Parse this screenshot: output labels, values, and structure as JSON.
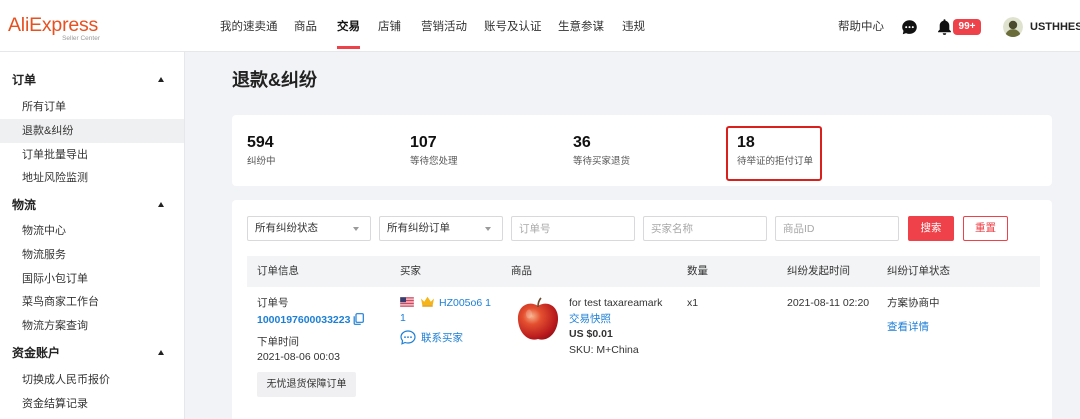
{
  "header": {
    "logo": {
      "brand": "AliExpress",
      "sub": "Seller Center"
    },
    "nav": [
      {
        "label": "我的速卖通",
        "active": false
      },
      {
        "label": "商品",
        "active": false
      },
      {
        "label": "交易",
        "active": true
      },
      {
        "label": "店铺",
        "active": false
      },
      {
        "label": "营销活动",
        "active": false
      },
      {
        "label": "账号及认证",
        "active": false
      },
      {
        "label": "生意参谋",
        "active": false
      },
      {
        "label": "违规",
        "active": false
      }
    ],
    "help": "帮助中心",
    "icons": {
      "messages": "chat-icon",
      "notifications": "bell-icon"
    },
    "notification_badge": "99+",
    "user_name": "USTHHES"
  },
  "sidebar": {
    "sections": [
      {
        "title": "订单",
        "expanded": true,
        "items": [
          {
            "label": "所有订单",
            "active": false
          },
          {
            "label": "退款&纠纷",
            "active": true
          },
          {
            "label": "订单批量导出",
            "active": false
          },
          {
            "label": "地址风险监测",
            "active": false
          }
        ]
      },
      {
        "title": "物流",
        "expanded": true,
        "items": [
          {
            "label": "物流中心",
            "active": false
          },
          {
            "label": "物流服务",
            "active": false
          },
          {
            "label": "国际小包订单",
            "active": false
          },
          {
            "label": "菜鸟商家工作台",
            "active": false
          },
          {
            "label": "物流方案查询",
            "active": false
          }
        ]
      },
      {
        "title": "资金账户",
        "expanded": true,
        "items": [
          {
            "label": "切换成人民币报价",
            "active": false
          },
          {
            "label": "资金结算记录",
            "active": false
          }
        ]
      }
    ]
  },
  "page": {
    "title": "退款&纠纷"
  },
  "stats": [
    {
      "value": 594,
      "label": "纠纷中",
      "highlighted": false
    },
    {
      "value": 107,
      "label": "等待您处理",
      "highlighted": false
    },
    {
      "value": 36,
      "label": "等待买家退货",
      "highlighted": false
    },
    {
      "value": 18,
      "label": "待举证的拒付订单",
      "highlighted": true
    }
  ],
  "filters": {
    "dispute_status": {
      "selected": "所有纠纷状态"
    },
    "dispute_orders": {
      "selected": "所有纠纷订单"
    },
    "order_no": {
      "value": "",
      "placeholder": "订单号"
    },
    "buyer_name": {
      "value": "",
      "placeholder": "买家名称"
    },
    "product_id": {
      "value": "",
      "placeholder": "商品ID"
    },
    "search_label": "搜索",
    "reset_label": "重置"
  },
  "table": {
    "columns": [
      "订单信息",
      "买家",
      "商品",
      "数量",
      "纠纷发起时间",
      "纠纷订单状态"
    ],
    "rows": [
      {
        "order_no_label": "订单号",
        "order_no": "1000197600033223",
        "order_time_label": "下单时间",
        "order_time": "2021-08-06 00:03",
        "order_tag": "无忧退货保障订单",
        "buyer": {
          "flag_icon": "us-flag-icon",
          "badge_icon": "crown-icon",
          "name": "HZ005o6 11",
          "contact_label": "联系买家"
        },
        "product": {
          "title": "for test taxareamark",
          "snapshot_link": "交易快照",
          "price": "US $0.01",
          "sku": "SKU: M+China"
        },
        "quantity": "x1",
        "dispute_time": "2021-08-11 02:20",
        "status": "方案协商中",
        "detail_link": "查看详情"
      }
    ]
  },
  "colors": {
    "brand": "#e8501f",
    "accent": "#ef4149",
    "highlight_border": "#d9201c",
    "link": "#1c7fd6"
  }
}
